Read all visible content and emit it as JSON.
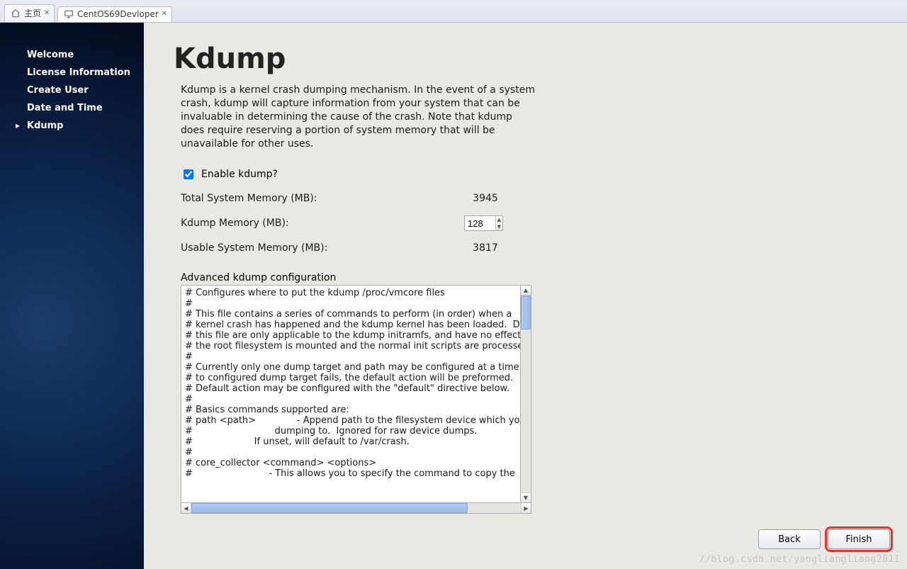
{
  "tabs": [
    {
      "label": "主页",
      "icon": "home"
    },
    {
      "label": "CentOS69Devloper",
      "icon": "monitor"
    }
  ],
  "sidebar": {
    "items": [
      {
        "label": "Welcome"
      },
      {
        "label": "License Information"
      },
      {
        "label": "Create User"
      },
      {
        "label": "Date and Time"
      },
      {
        "label": "Kdump"
      }
    ],
    "current_index": 4
  },
  "page": {
    "title": "Kdump",
    "description": "Kdump is a kernel crash dumping mechanism. In the event of a system crash, kdump will capture information from your system that can be invaluable in determining the cause of the crash. Note that kdump does require reserving a portion of system memory that will be unavailable for other uses.",
    "enable_checkbox_label": "Enable kdump?",
    "enable_checked": true,
    "total_mem_label": "Total System Memory (MB):",
    "total_mem_value": "3945",
    "kdump_mem_label": "Kdump Memory (MB):",
    "kdump_mem_value": "128",
    "usable_mem_label": "Usable System Memory (MB):",
    "usable_mem_value": "3817",
    "adv_label": "Advanced kdump configuration",
    "config_text": "# Configures where to put the kdump /proc/vmcore files\n#\n# This file contains a series of commands to perform (in order) when a\n# kernel crash has happened and the kdump kernel has been loaded.  Directives in\n# this file are only applicable to the kdump initramfs, and have no effect if\n# the root filesystem is mounted and the normal init scripts are processed\n#\n# Currently only one dump target and path may be configured at a time. If dumping\n# to configured dump target fails, the default action will be preformed.\n# Default action may be configured with the \"default\" directive below.\n#\n# Basics commands supported are:\n# path <path>              - Append path to the filesystem device which you are\n#                            dumping to.  Ignored for raw device dumps.\n#                     If unset, will default to /var/crash.\n#\n# core_collector <command> <options>\n#                          - This allows you to specify the command to copy the"
  },
  "buttons": {
    "back_label": "Back",
    "finish_label": "Finish"
  },
  "watermark": "//blog.csdn.net/yangliangliang2011"
}
